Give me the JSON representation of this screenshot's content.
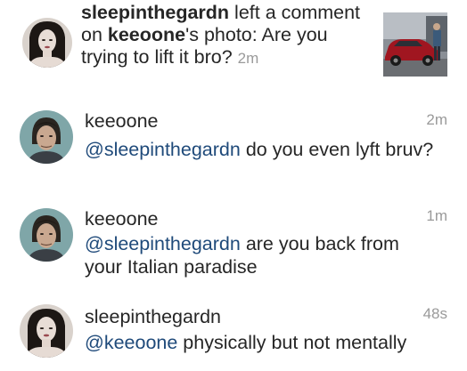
{
  "notification": {
    "username": "sleepinthegardn",
    "action_before": " left a comment on ",
    "target_user": "keeoone",
    "action_after": "'s photo: ",
    "comment": "Are you trying to lift it bro?",
    "time": "2m",
    "avatar_icon": "user-avatar-dark-hair",
    "thumbnail_icon": "photo-thumbnail-car"
  },
  "comments": [
    {
      "username": "keeoone",
      "time": "2m",
      "mention": "@sleepinthegardn",
      "text": " do you even lyft bruv?",
      "avatar_icon": "user-avatar-man"
    },
    {
      "username": "keeoone",
      "time": "1m",
      "mention": "@sleepinthegardn",
      "text": " are you back from your Italian paradise",
      "avatar_icon": "user-avatar-man"
    },
    {
      "username": "sleepinthegardn",
      "time": "48s",
      "mention": "@keeoone",
      "text": " physically but not mentally",
      "avatar_icon": "user-avatar-dark-hair"
    }
  ],
  "colors": {
    "text": "#262626",
    "muted": "#9a9a9a",
    "mention": "#1f4a7a"
  }
}
